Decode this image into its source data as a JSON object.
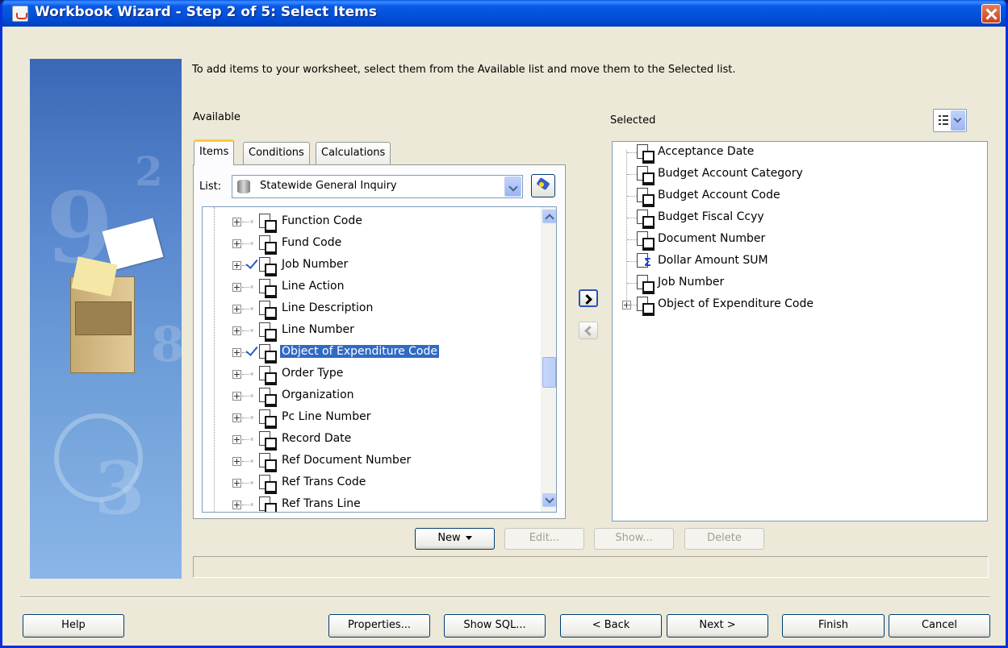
{
  "window": {
    "title": "Workbook Wizard - Step 2 of 5: Select Items"
  },
  "instruction": "To add items to your worksheet, select them from the Available list and move them to the Selected list.",
  "available": {
    "label": "Available",
    "tabs": [
      "Items",
      "Conditions",
      "Calculations"
    ],
    "active_tab": "Items",
    "list_label": "List:",
    "list_value": "Statewide General Inquiry",
    "items": [
      {
        "label": "Function Code",
        "checked": false
      },
      {
        "label": "Fund Code",
        "checked": false
      },
      {
        "label": "Job Number",
        "checked": true
      },
      {
        "label": "Line Action",
        "checked": false
      },
      {
        "label": "Line Description",
        "checked": false
      },
      {
        "label": "Line Number",
        "checked": false
      },
      {
        "label": "Object of Expenditure Code",
        "checked": true,
        "selected": true
      },
      {
        "label": "Order Type",
        "checked": false
      },
      {
        "label": "Organization",
        "checked": false
      },
      {
        "label": "Pc Line Number",
        "checked": false
      },
      {
        "label": "Record Date",
        "checked": false
      },
      {
        "label": "Ref Document Number",
        "checked": false
      },
      {
        "label": "Ref Trans Code",
        "checked": false
      },
      {
        "label": "Ref Trans Line",
        "checked": false
      }
    ]
  },
  "selected": {
    "label": "Selected",
    "items": [
      {
        "label": "Acceptance Date",
        "icon": "item-icon"
      },
      {
        "label": "Budget Account Category",
        "icon": "item-icon"
      },
      {
        "label": "Budget Account Code",
        "icon": "item-icon"
      },
      {
        "label": "Budget Fiscal Ccyy",
        "icon": "item-icon"
      },
      {
        "label": "Document Number",
        "icon": "item-icon"
      },
      {
        "label": "Dollar Amount SUM",
        "icon": "sum-icon"
      },
      {
        "label": "Job Number",
        "icon": "item-icon"
      },
      {
        "label": "Object of Expenditure Code",
        "icon": "item-icon",
        "expandable": true
      }
    ]
  },
  "actions": {
    "new": "New",
    "edit": "Edit...",
    "show": "Show...",
    "delete": "Delete"
  },
  "footer": {
    "help": "Help",
    "properties": "Properties...",
    "show_sql": "Show SQL...",
    "back": "< Back",
    "next": "Next >",
    "finish": "Finish",
    "cancel": "Cancel"
  }
}
